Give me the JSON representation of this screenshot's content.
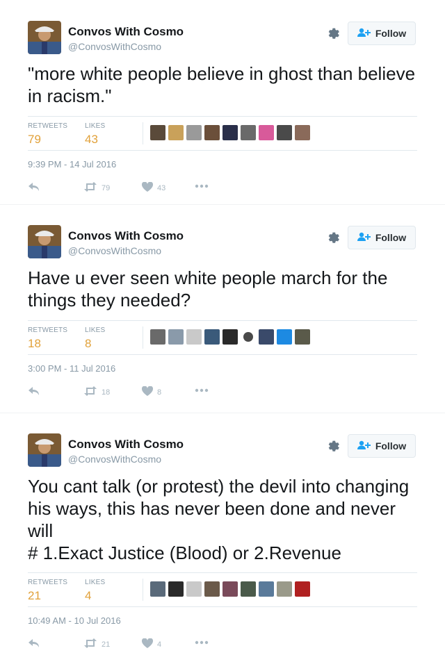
{
  "colors": {
    "accent": "#e1a13a",
    "muted": "#8899a6",
    "icon": "#aab8c2"
  },
  "follow_label": "Follow",
  "stat_labels": {
    "retweets": "RETWEETS",
    "likes": "LIKES"
  },
  "tweets": [
    {
      "name": "Convos With Cosmo",
      "handle": "@ConvosWithCosmo",
      "text": "\"more white people believe in ghost than believe in racism.\"",
      "retweets": "79",
      "likes": "43",
      "timestamp": "9:39 PM - 14 Jul 2016",
      "retweet_count": "79",
      "like_count": "43",
      "liker_avatars": 9
    },
    {
      "name": "Convos With Cosmo",
      "handle": "@ConvosWithCosmo",
      "text": "Have u ever seen white people march for the things they needed?",
      "retweets": "18",
      "likes": "8",
      "timestamp": "3:00 PM - 11 Jul 2016",
      "retweet_count": "18",
      "like_count": "8",
      "liker_avatars": 9
    },
    {
      "name": "Convos With Cosmo",
      "handle": "@ConvosWithCosmo",
      "text": "You cant talk (or protest) the devil into changing his ways, this has never been done and never will\n# 1.Exact Justice (Blood) or 2.Revenue",
      "retweets": "21",
      "likes": "4",
      "timestamp": "10:49 AM - 10 Jul 2016",
      "retweet_count": "21",
      "like_count": "4",
      "liker_avatars": 9
    }
  ]
}
